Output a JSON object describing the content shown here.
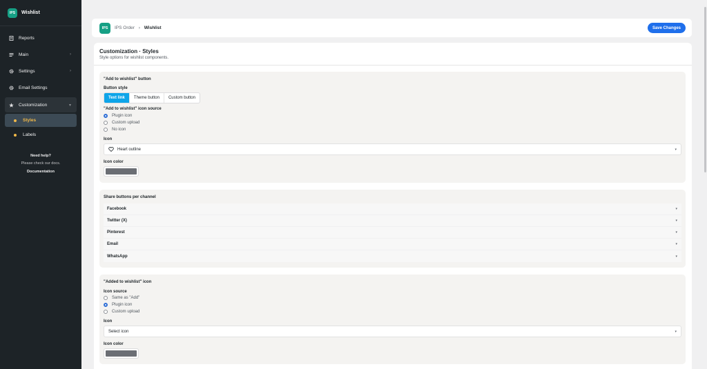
{
  "brand": {
    "logo": "IPS",
    "name": "Wishlist"
  },
  "nav": {
    "reports": "Reports",
    "main": "Main",
    "settings": "Settings",
    "email_settings": "Email Settings",
    "customization": "Customization",
    "styles": "Styles",
    "labels": "Labels"
  },
  "help": {
    "title": "Need help?",
    "subtitle": "Please check our docs.",
    "link": "Documentation"
  },
  "header": {
    "logo": "IPS",
    "breadcrumb_root": "IPS Order",
    "breadcrumb_sep": "›",
    "breadcrumb_current": "Wishlist",
    "save_label": "Save Changes"
  },
  "page": {
    "title": "Customization · Styles",
    "subtitle": "Style options for wishlist components."
  },
  "add_button": {
    "title": "\"Add to wishlist\" button",
    "style_label": "Button style",
    "styles": [
      "Text link",
      "Theme button",
      "Custom button"
    ],
    "selected_style": "Text link",
    "icon_source_label": "\"Add to wishlist\" icon source",
    "icon_sources": [
      "Plugin icon",
      "Custom upload",
      "No icon"
    ],
    "selected_source": "Plugin icon",
    "icon_label": "Icon",
    "icon_value": "Heart outline",
    "icon_color_label": "Icon color",
    "icon_color": "#6b6e74"
  },
  "share": {
    "title": "Share buttons per channel",
    "channels": [
      "Facebook",
      "Twitter (X)",
      "Pinterest",
      "Email",
      "WhatsApp"
    ]
  },
  "added_icon": {
    "title": "\"Added to wishlist\" icon",
    "source_label": "Icon source",
    "sources": [
      "Same as \"Add\"",
      "Plugin icon",
      "Custom upload"
    ],
    "selected_source": "Plugin icon",
    "icon_label": "Icon",
    "icon_placeholder": "Select icon",
    "icon_color_label": "Icon color",
    "icon_color": "#6b6e74"
  },
  "colors": {
    "accent": "#1f6feb",
    "segment_active": "#0ea5e9",
    "brand": "#16a085",
    "sidebar": "#1d2327",
    "sidebar_highlight": "#f0b849"
  },
  "icons": [
    "document-icon",
    "list-icon",
    "gear-icon",
    "gear-icon",
    "star-icon",
    "heart-icon",
    "chevron-icon"
  ]
}
